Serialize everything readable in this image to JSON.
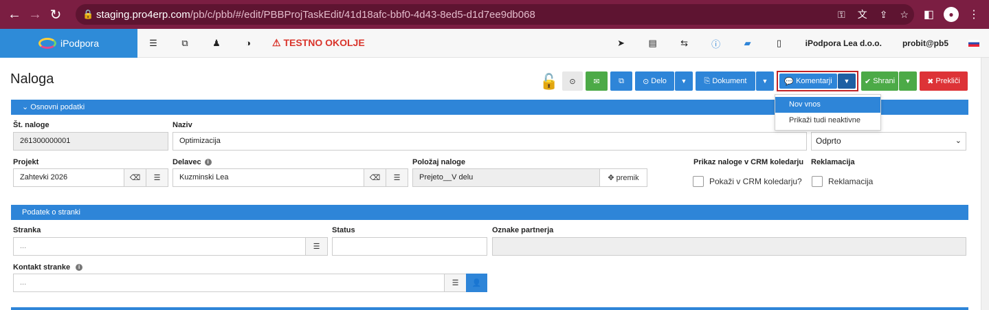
{
  "browser": {
    "back_icon": "arrow-left-icon",
    "forward_icon": "arrow-right-icon",
    "reload_icon": "reload-icon",
    "url_host": "staging.pro4erp.com",
    "url_path": "/pb/c/pbb/#/edit/PBBProjTaskEdit/41d18afc-bbf0-4d43-8ed5-d1d7ee9db068"
  },
  "app": {
    "brand": "iPodpora",
    "warning": "⚠ TESTNO OKOLJE",
    "company": "iPodpora Lea d.o.o.",
    "user": "probit@pb5"
  },
  "page": {
    "title": "Naloga"
  },
  "toolbar": {
    "delo_label": "Delo",
    "dokument_label": "Dokument",
    "komentarji_label": "Komentarji",
    "shrani_label": "Shrani",
    "preklici_label": "Prekliči"
  },
  "komentarji_menu": {
    "items": [
      "Nov vnos",
      "Prikaži tudi neaktivne"
    ]
  },
  "basic": {
    "section_title": "Osnovni podatki",
    "st_naloge_label": "Št. naloge",
    "st_naloge_value": "261300000001",
    "naziv_label": "Naziv",
    "naziv_value": "Optimizacija",
    "status_value": "Odprto",
    "projekt_label": "Projekt",
    "projekt_value": "Zahtevki 2026",
    "delavec_label": "Delavec",
    "delavec_value": "Kuzminski Lea",
    "polozaj_label": "Položaj naloge",
    "polozaj_value": "Prejeto__V delu",
    "premik_label": "premik",
    "crm_label": "Prikaz naloge v CRM koledarju",
    "crm_check_label": "Pokaži v CRM koledarju?",
    "reklamacija_label": "Reklamacija",
    "reklamacija_check_label": "Reklamacija"
  },
  "customer": {
    "section_title": "Podatek o stranki",
    "stranka_label": "Stranka",
    "stranka_placeholder": "...",
    "status_label": "Status",
    "oznake_label": "Oznake partnerja",
    "kontakt_label": "Kontakt stranke",
    "kontakt_placeholder": "..."
  }
}
